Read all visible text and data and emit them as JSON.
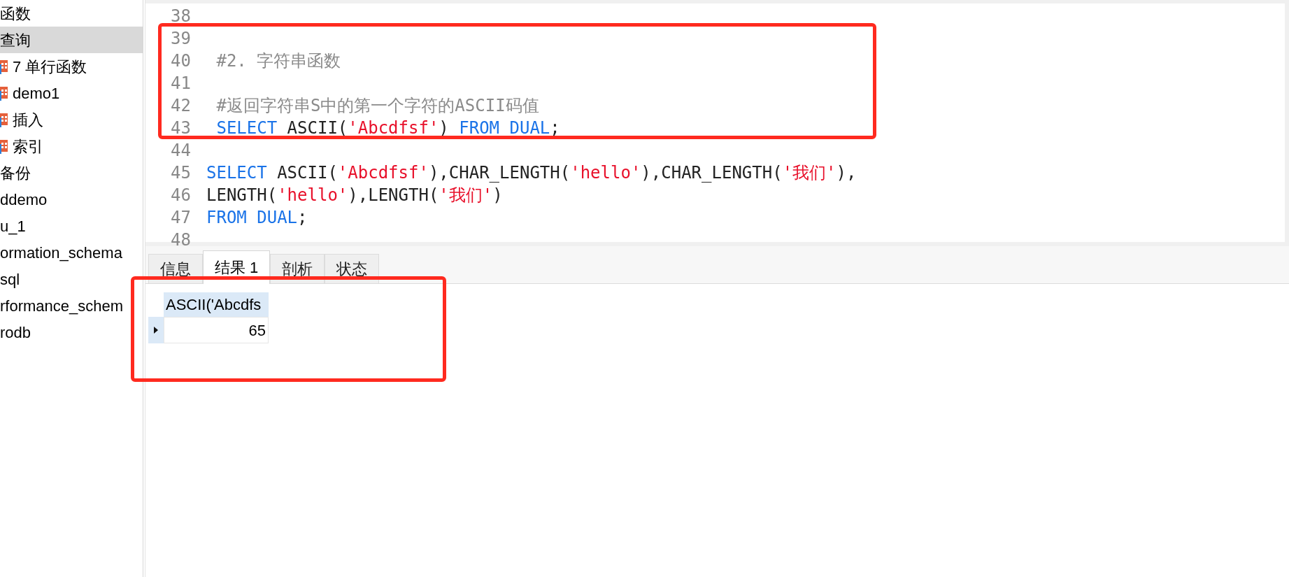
{
  "sidebar": {
    "items": [
      {
        "label": "函数",
        "kind": "folder",
        "selected": false
      },
      {
        "label": "查询",
        "kind": "folder",
        "selected": true
      },
      {
        "label": "7 单行函数",
        "kind": "query",
        "selected": false
      },
      {
        "label": "demo1",
        "kind": "query",
        "selected": false
      },
      {
        "label": "插入",
        "kind": "query",
        "selected": false
      },
      {
        "label": "索引",
        "kind": "query",
        "selected": false
      },
      {
        "label": "备份",
        "kind": "folder",
        "selected": false
      },
      {
        "label": "ddemo",
        "kind": "database",
        "selected": false
      },
      {
        "label": "u_1",
        "kind": "database",
        "selected": false
      },
      {
        "label": "ormation_schema",
        "kind": "database",
        "selected": false
      },
      {
        "label": "sql",
        "kind": "database",
        "selected": false
      },
      {
        "label": "rformance_schem",
        "kind": "database",
        "selected": false
      },
      {
        "label": "rodb",
        "kind": "database",
        "selected": false
      }
    ]
  },
  "editor": {
    "lines": [
      {
        "number": "38"
      },
      {
        "number": "39"
      },
      {
        "number": "40",
        "tokens": [
          {
            "kind": "comment",
            "text": " #2. 字符串函数"
          }
        ]
      },
      {
        "number": "41"
      },
      {
        "number": "42",
        "tokens": [
          {
            "kind": "comment",
            "text": " #返回字符串S中的第一个字符的ASCII码值"
          }
        ]
      },
      {
        "number": "43",
        "tokens": [
          {
            "kind": "keyword",
            "text": " SELECT"
          },
          {
            "kind": "plain",
            "text": " ASCII("
          },
          {
            "kind": "string",
            "text": "'Abcdfsf'"
          },
          {
            "kind": "plain",
            "text": ") "
          },
          {
            "kind": "keyword",
            "text": "FROM DUAL"
          },
          {
            "kind": "plain",
            "text": ";"
          }
        ]
      },
      {
        "number": "44"
      },
      {
        "number": "45",
        "tokens": [
          {
            "kind": "keyword",
            "text": "SELECT"
          },
          {
            "kind": "plain",
            "text": " ASCII("
          },
          {
            "kind": "string",
            "text": "'Abcdfsf'"
          },
          {
            "kind": "plain",
            "text": "),CHAR_LENGTH("
          },
          {
            "kind": "string",
            "text": "'hello'"
          },
          {
            "kind": "plain",
            "text": "),CHAR_LENGTH("
          },
          {
            "kind": "string",
            "text": "'我们'"
          },
          {
            "kind": "plain",
            "text": "),"
          }
        ]
      },
      {
        "number": "46",
        "tokens": [
          {
            "kind": "plain",
            "text": "LENGTH("
          },
          {
            "kind": "string",
            "text": "'hello'"
          },
          {
            "kind": "plain",
            "text": "),LENGTH("
          },
          {
            "kind": "string",
            "text": "'我们'"
          },
          {
            "kind": "plain",
            "text": ")"
          }
        ]
      },
      {
        "number": "47",
        "tokens": [
          {
            "kind": "keyword",
            "text": "FROM DUAL"
          },
          {
            "kind": "plain",
            "text": ";"
          }
        ]
      },
      {
        "number": "48"
      }
    ]
  },
  "result_tabs": [
    {
      "label": "信息",
      "selected": false
    },
    {
      "label": "结果 1",
      "selected": true
    },
    {
      "label": "剖析",
      "selected": false
    },
    {
      "label": "状态",
      "selected": false
    }
  ],
  "result_grid": {
    "columns": [
      "ASCII('Abcdfs"
    ],
    "rows": [
      {
        "selected": true,
        "cells": [
          "65"
        ]
      }
    ]
  }
}
